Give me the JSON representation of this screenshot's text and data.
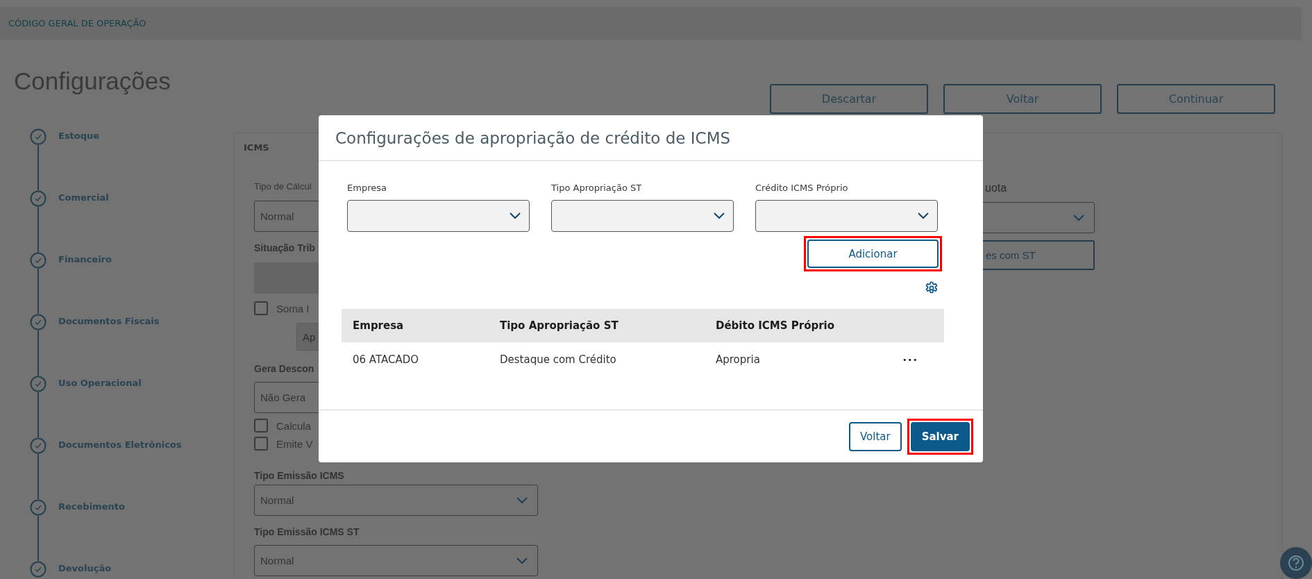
{
  "header": {
    "title": "CÓDIGO GERAL DE OPERAÇÃO"
  },
  "page_title": "Configurações",
  "actions": [
    "Descartar",
    "Voltar",
    "Continuar"
  ],
  "steps": [
    {
      "label": "Estoque",
      "done": true
    },
    {
      "label": "Comercial",
      "done": true
    },
    {
      "label": "Financeiro",
      "done": true
    },
    {
      "label": "Documentos Fiscais",
      "done": true
    },
    {
      "label": "Uso Operacional",
      "done": true
    },
    {
      "label": "Documentos Eletrônicos",
      "done": true
    },
    {
      "label": "Recebimento",
      "done": true
    },
    {
      "label": "Devolução",
      "done": true
    }
  ],
  "icms_panel": {
    "title": "ICMS",
    "left_items": [
      {
        "kind": "caption",
        "text": "Tipo de Cálcul"
      },
      {
        "kind": "input",
        "value": "Normal"
      },
      {
        "kind": "heading",
        "text": "Situação Trib"
      },
      {
        "kind": "blank"
      },
      {
        "kind": "checkbox",
        "label": "Soma I",
        "checked": false
      },
      {
        "kind": "button",
        "label": "Ap"
      },
      {
        "kind": "heading",
        "text": "Gera Descon"
      },
      {
        "kind": "input",
        "value": "Não Gera"
      },
      {
        "kind": "checkbox",
        "label": "Calcula",
        "checked": false
      },
      {
        "kind": "checkbox",
        "label": "Emite V",
        "checked": false
      },
      {
        "kind": "heading",
        "text": "Tipo Emissão ICMS"
      },
      {
        "kind": "select",
        "value": "Normal"
      },
      {
        "kind": "heading",
        "text": "Tipo Emissão ICMS ST"
      },
      {
        "kind": "select",
        "value": "Normal"
      }
    ],
    "right_items": [
      {
        "kind": "caption",
        "text": "uota"
      },
      {
        "kind": "select",
        "value": ""
      },
      {
        "kind": "button",
        "label": "es com ST"
      }
    ]
  },
  "modal": {
    "title": "Configurações de apropriação de crédito de ICMS",
    "fields": [
      {
        "label": "Empresa"
      },
      {
        "label": "Tipo Apropriação ST"
      },
      {
        "label": "Crédito ICMS Próprio"
      }
    ],
    "add_button": {
      "label": "Adicionar",
      "highlighted": true
    },
    "table": {
      "columns": [
        "Empresa",
        "Tipo Apropriação ST",
        "Débito ICMS Próprio"
      ],
      "rows": [
        {
          "cells": [
            "06 ATACADO",
            "Destaque com Crédito",
            "Apropria"
          ],
          "menu": "•••"
        }
      ]
    },
    "buttons": [
      {
        "label": "Voltar",
        "kind": "secondary",
        "highlighted": false
      },
      {
        "label": "Salvar",
        "kind": "primary",
        "highlighted": true
      }
    ]
  }
}
